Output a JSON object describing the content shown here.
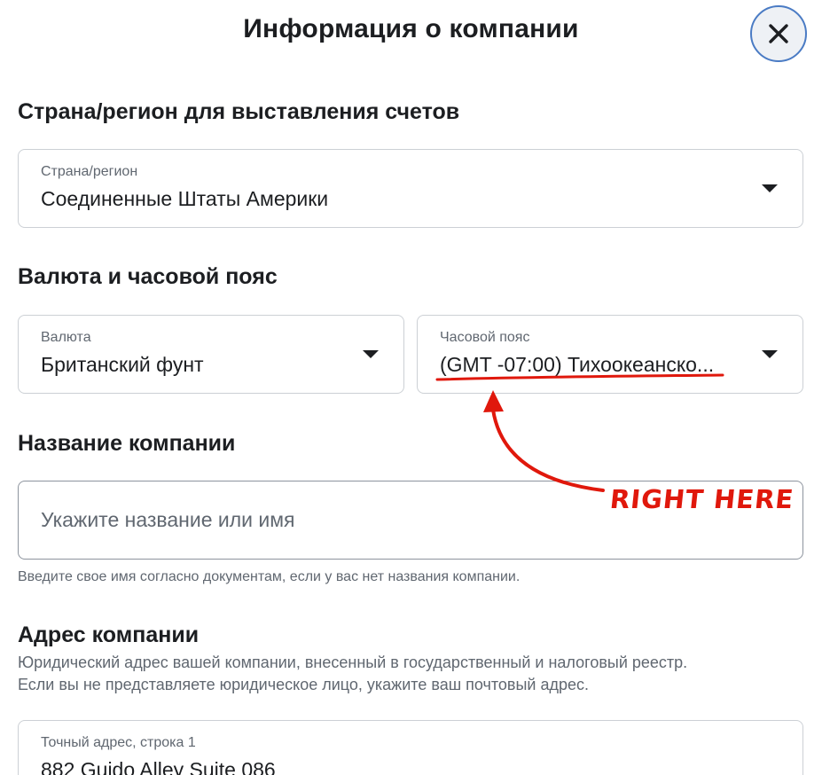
{
  "dialog": {
    "title": "Информация о компании",
    "close_icon": "close-icon"
  },
  "billing": {
    "heading": "Страна/регион для выставления счетов",
    "country_label": "Страна/регион",
    "country_value": "Соединенные Штаты Америки"
  },
  "currency_timezone": {
    "heading": "Валюта и часовой пояс",
    "currency_label": "Валюта",
    "currency_value": "Британский фунт",
    "timezone_label": "Часовой пояс",
    "timezone_value": "(GMT -07:00) Тихоокеанско..."
  },
  "company_name": {
    "heading": "Название компании",
    "placeholder": "Укажите название или имя",
    "helper": "Введите свое имя согласно документам, если у вас нет названия компании."
  },
  "company_address": {
    "heading": "Адрес компании",
    "description_line1": "Юридический адрес вашей компании, внесенный в государственный и налоговый реестр.",
    "description_line2": "Если вы не представляете юридическое лицо, укажите ваш почтовый адрес.",
    "street_label": "Точный адрес, строка 1",
    "street_value": "882 Guido Alley Suite 086"
  },
  "annotation": {
    "text": "RIGHT HERE",
    "color": "#e0180c"
  },
  "colors": {
    "close_border": "#4a7bc4",
    "field_border": "#ccd0d5",
    "secondary_text": "#606770"
  }
}
